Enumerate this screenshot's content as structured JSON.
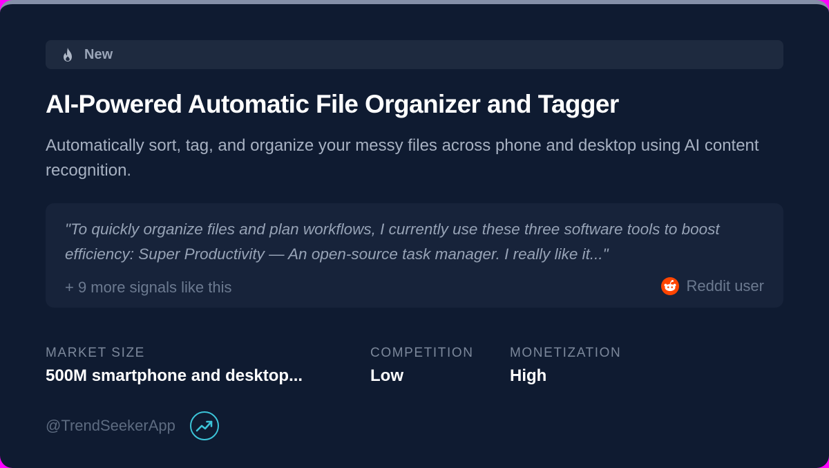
{
  "badge": {
    "icon": "flame-icon",
    "label": "New"
  },
  "idea": {
    "title": "AI-Powered Automatic File Organizer and Tagger",
    "description": "Automatically sort, tag, and organize your messy files across phone and desktop using AI content recognition."
  },
  "signal": {
    "quote": "\"To quickly organize files and plan workflows, I currently use these three software tools to boost efficiency: Super Productivity — An open-source task manager. I really like it...\"",
    "more": "+ 9 more signals like this",
    "source_icon": "reddit-icon",
    "source": "Reddit user"
  },
  "metrics": [
    {
      "label": "MARKET SIZE",
      "value": "500M smartphone and desktop..."
    },
    {
      "label": "COMPETITION",
      "value": "Low"
    },
    {
      "label": "MONETIZATION",
      "value": "High"
    }
  ],
  "footer": {
    "handle": "@TrendSeekerApp",
    "icon": "trending-up-icon"
  },
  "colors": {
    "background": "#0f1b31",
    "accent": "#3cc4d8",
    "reddit": "#ff4500"
  }
}
